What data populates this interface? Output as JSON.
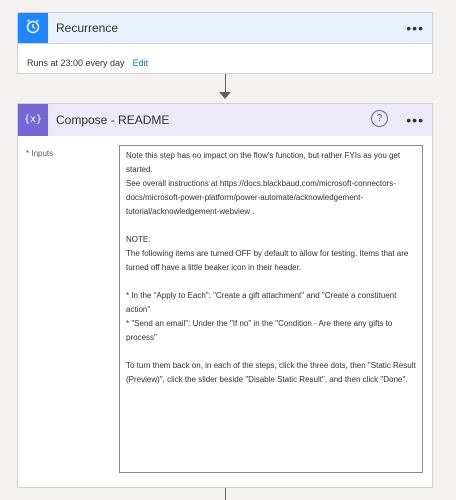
{
  "recurrence": {
    "title": "Recurrence",
    "menu": "•••",
    "summary": "Runs at 23:00 every day",
    "edit_label": "Edit",
    "accent": "#1f85ff"
  },
  "compose": {
    "title": "Compose - README",
    "menu": "•••",
    "info": "?",
    "inputs_required_mark": "*",
    "inputs_label": "Inputs",
    "accent": "#7568d4",
    "header_bg": "#ece9f8",
    "text": "Note this step has no impact on the flow's function, but rather FYIs as you get started.\nSee overall instructions at https://docs.blackbaud.com/microsoft-connectors-docs/microsoft-power-platform/power-automate/acknowledgement-tutorial/acknowledgement-webview .\n\nNOTE:\nThe following items are turned OFF by default to allow for testing. Items that are turned off have a little beaker icon in their header.\n\n* In the \"Apply to Each\": \"Create a gift attachment\" and \"Create a constituent action\"\n* \"Send an email\": Under the \"If no\" in the \"Condition - Are there any gifts to process\"\n\nTo turn them back on, in each of the steps, click the three dots, then \"Static Result (Preview)\", click the slider beside \"Disable Static Result\", and then click \"Done\"."
  }
}
